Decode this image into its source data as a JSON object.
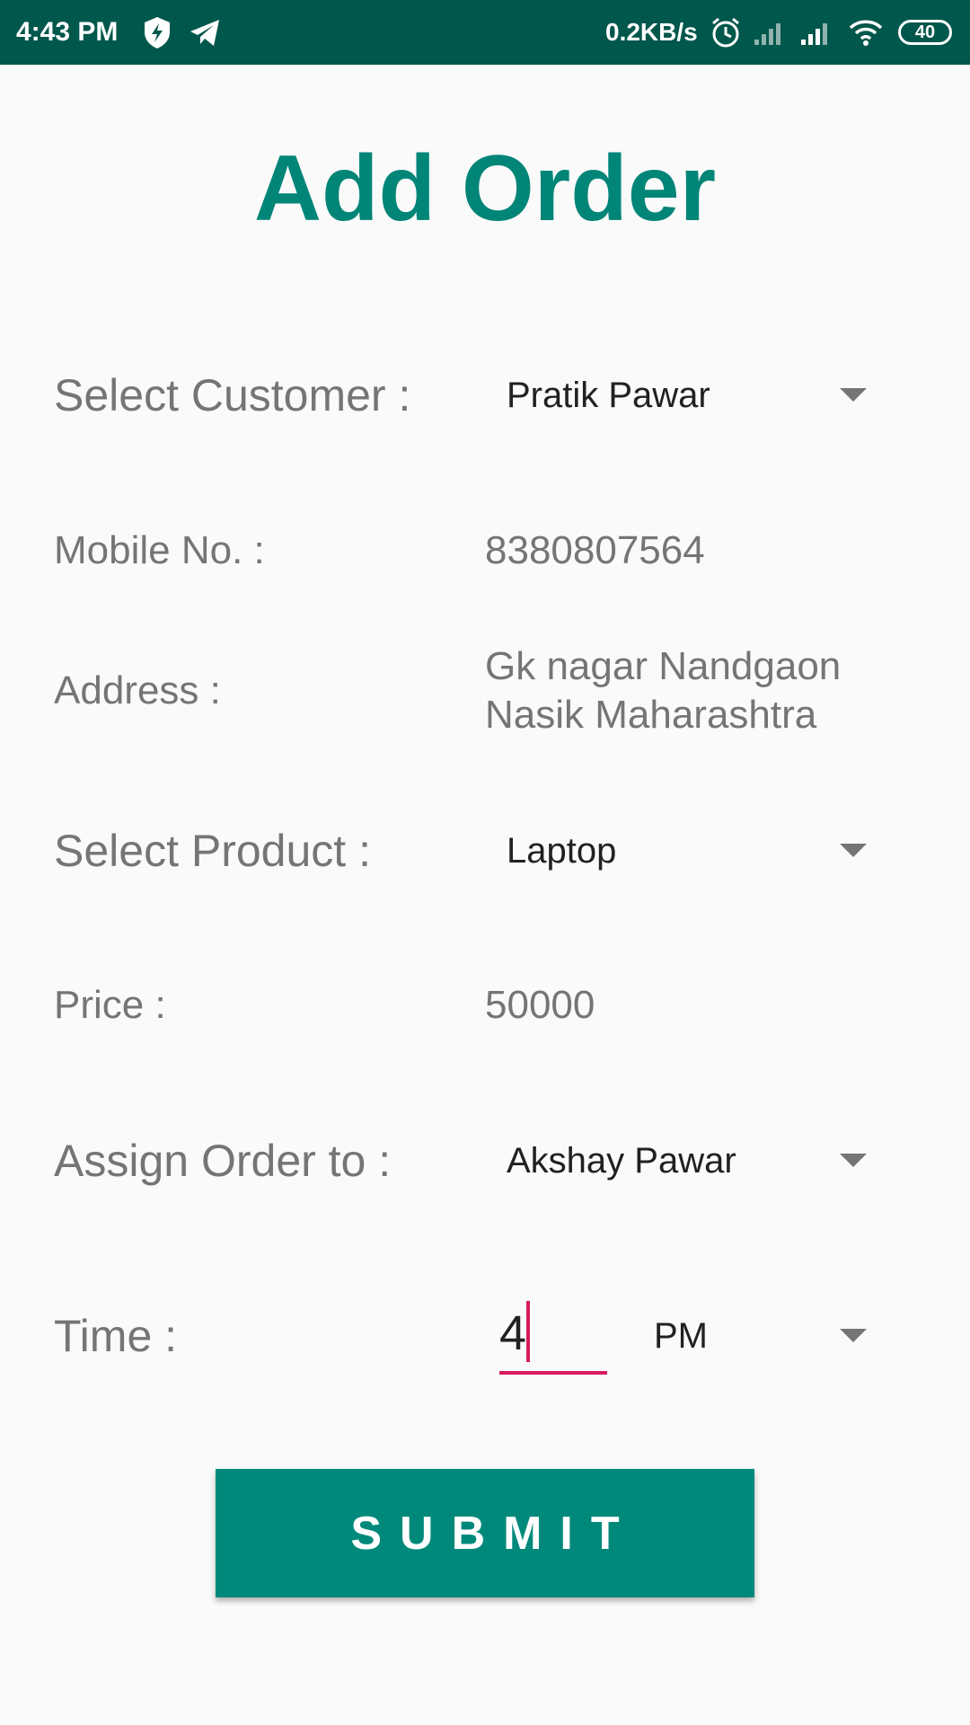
{
  "status_bar": {
    "time": "4:43 PM",
    "net_speed": "0.2KB/s",
    "battery": "40",
    "icons": [
      "shield-bolt-icon",
      "telegram-icon",
      "alarm-icon",
      "signal-icon",
      "signal-icon",
      "wifi-icon",
      "battery-icon"
    ]
  },
  "page": {
    "title": "Add Order"
  },
  "form": {
    "customer": {
      "label": "Select Customer :",
      "selected": "Pratik Pawar"
    },
    "mobile": {
      "label": "Mobile No. :",
      "value": "8380807564"
    },
    "address": {
      "label": "Address :",
      "line1": "Gk nagar Nandgaon",
      "line2": "Nasik Maharashtra"
    },
    "product": {
      "label": "Select Product :",
      "selected": "Laptop"
    },
    "price": {
      "label": "Price :",
      "value": "50000"
    },
    "assign": {
      "label": "Assign Order to :",
      "selected": "Akshay Pawar"
    },
    "time": {
      "label": "Time :",
      "value": "4",
      "period": "PM"
    }
  },
  "submit_label": "SUBMIT",
  "colors": {
    "status_bar": "#00574b",
    "accent": "#008577",
    "button": "#00897b",
    "cursor": "#d81b60"
  }
}
